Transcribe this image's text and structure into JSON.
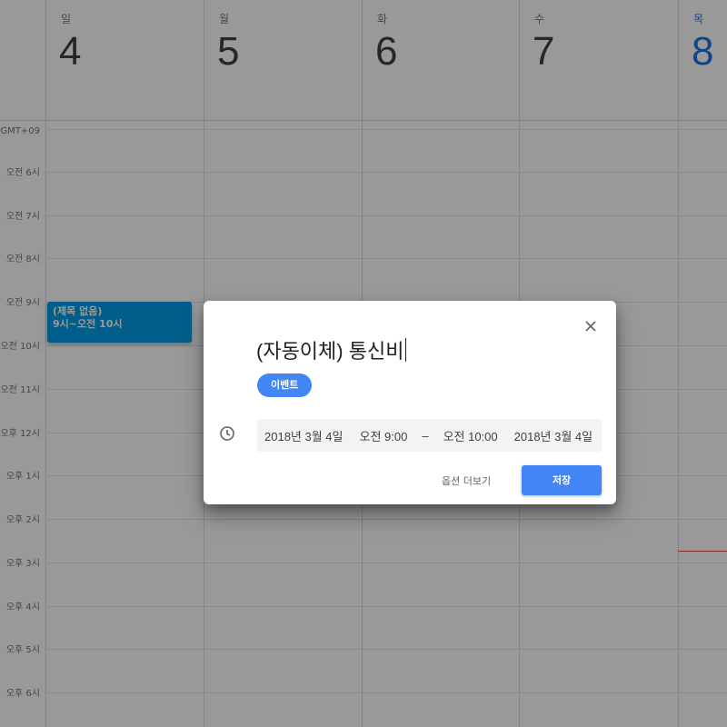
{
  "calendar": {
    "timezone": "GMT+09",
    "days": [
      {
        "dow": "일",
        "num": "4"
      },
      {
        "dow": "월",
        "num": "5"
      },
      {
        "dow": "화",
        "num": "6"
      },
      {
        "dow": "수",
        "num": "7"
      },
      {
        "dow": "목",
        "num": "8"
      }
    ],
    "hours": [
      "오전 6시",
      "오전 7시",
      "오전 8시",
      "오전 9시",
      "오전 10시",
      "오전 11시",
      "오후 12시",
      "오후 1시",
      "오후 2시",
      "오후 3시",
      "오후 4시",
      "오후 5시",
      "오후 6시"
    ],
    "event": {
      "title": "(제목 없음)",
      "time": "9시~오전 10시"
    }
  },
  "dialog": {
    "title": "(자동이체) 통신비",
    "chip": "이벤트",
    "start_date": "2018년 3월 4일",
    "start_time": "오전 9:00",
    "separator": "–",
    "end_time": "오전 10:00",
    "end_date": "2018년 3월 4일",
    "more_options": "옵션 더보기",
    "save": "저장"
  },
  "colors": {
    "accent": "#4285f4",
    "today": "#1a73e8",
    "event": "#039be5",
    "now_line": "#ea4335"
  },
  "icons": {
    "close": "close-icon",
    "clock": "clock-icon"
  }
}
